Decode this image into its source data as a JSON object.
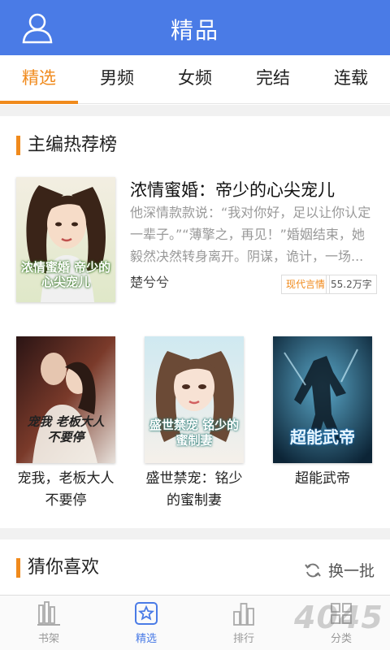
{
  "header": {
    "title": "精品",
    "user_icon": "user-icon"
  },
  "tabs": [
    {
      "label": "精选",
      "active": true
    },
    {
      "label": "男频",
      "active": false
    },
    {
      "label": "女频",
      "active": false
    },
    {
      "label": "完结",
      "active": false
    },
    {
      "label": "连载",
      "active": false
    }
  ],
  "colors": {
    "brand": "#4a7be6",
    "accent": "#f08a1c"
  },
  "recommend": {
    "section_title": "主编热荐榜",
    "featured": {
      "title": "浓情蜜婚：帝少的心尖宠儿",
      "description": "他深情款款说：“我对你好，足以让你认定一辈子。”“薄擎之，再见！”婚姻结束，她毅然决然转身离开。阴谋，诡计，一场...",
      "author": "楚兮兮",
      "genre": "现代言情",
      "words": "55.2万字",
      "cover_text": "浓情蜜婚 帝少的心尖宠儿"
    },
    "books": [
      {
        "name": "宠我，老板大人不要停",
        "cover_text": "宠我 老板大人不要停"
      },
      {
        "name": "盛世禁宠：铭少的蜜制妻",
        "cover_text": "盛世禁宠 铭少的蜜制妻"
      },
      {
        "name": "超能武帝",
        "cover_text": "超能武帝"
      }
    ]
  },
  "guess": {
    "section_title": "猜你喜欢",
    "refresh_label": "换一批",
    "refresh_icon": "refresh-icon"
  },
  "bottom_nav": [
    {
      "label": "书架",
      "icon": "bookshelf-icon",
      "active": false
    },
    {
      "label": "精选",
      "icon": "star-icon",
      "active": true
    },
    {
      "label": "排行",
      "icon": "ranking-icon",
      "active": false
    },
    {
      "label": "分类",
      "icon": "category-icon",
      "active": false
    }
  ],
  "watermark": "4045"
}
